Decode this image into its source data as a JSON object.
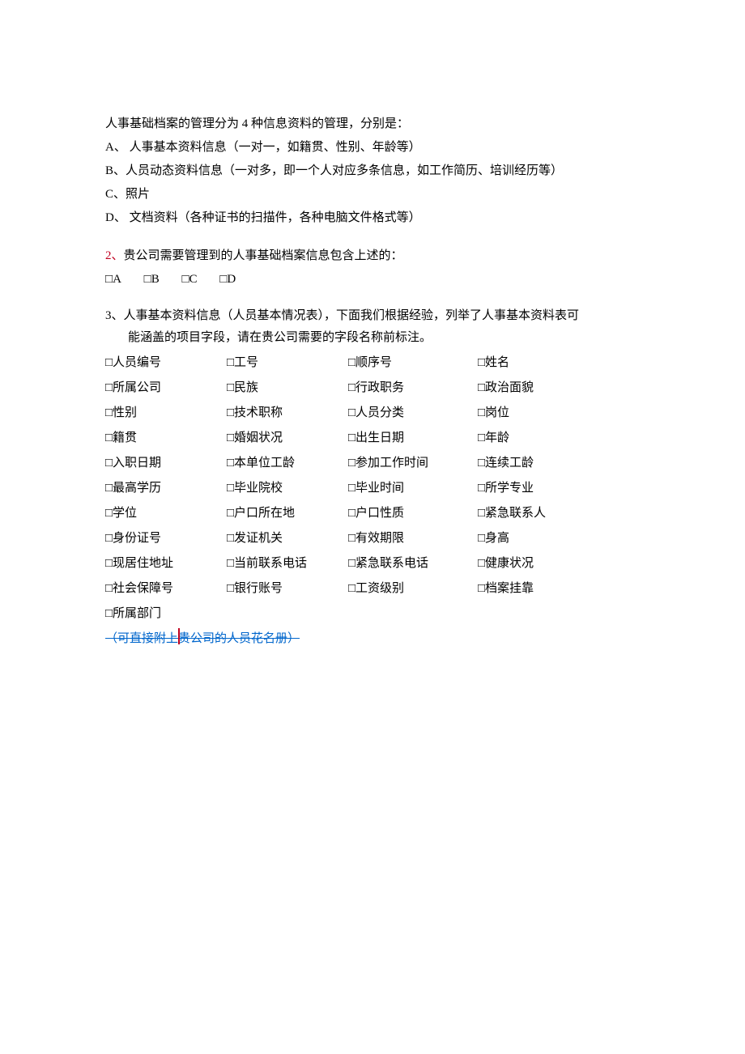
{
  "intro": "人事基础档案的管理分为 4 种信息资料的管理，分别是：",
  "types": {
    "A": "A、 人事基本资料信息（一对一，如籍贯、性别、年龄等）",
    "B": "B、人员动态资料信息（一对多，即一个人对应多条信息，如工作简历、培训经历等）",
    "C": "C、照片",
    "D": "D、 文档资料（各种证书的扫描件，各种电脑文件格式等）"
  },
  "q2": {
    "num": "2、",
    "text": "贵公司需要管理到的人事基础档案信息包含上述的：",
    "options": [
      "A",
      "B",
      "C",
      "D"
    ]
  },
  "q3": {
    "num": "3、",
    "line1": "人事基本资料信息（人员基本情况表），下面我们根据经验，列举了人事基本资料表可",
    "line2": "能涵盖的项目字段，请在贵公司需要的字段名称前标注。"
  },
  "fields": [
    "人员编号",
    "工号",
    "顺序号",
    "姓名",
    "所属公司",
    "民族",
    "行政职务",
    "政治面貌",
    "性别",
    "技术职称",
    "人员分类",
    "岗位",
    "籍贯",
    "婚姻状况",
    "出生日期",
    "年龄",
    "入职日期",
    "本单位工龄",
    "参加工作时间",
    "连续工龄",
    "最高学历",
    "毕业院校",
    "毕业时间",
    "所学专业",
    "学位",
    "户口所在地",
    "户口性质",
    "紧急联系人",
    "身份证号",
    "发证机关",
    "有效期限",
    "身高",
    "现居住地址",
    "当前联系电话",
    "紧急联系电话",
    "健康状况",
    "社会保障号",
    "银行账号",
    "工资级别",
    "档案挂靠",
    "所属部门"
  ],
  "strike_note": "（可直接附上贵公司的人员花名册）",
  "checkbox_glyph": "□"
}
